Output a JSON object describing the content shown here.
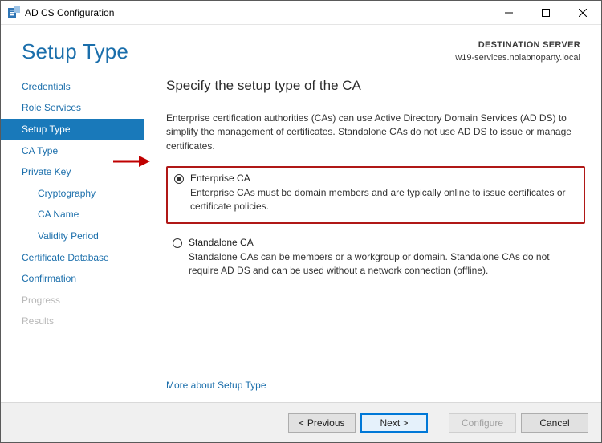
{
  "window": {
    "title": "AD CS Configuration"
  },
  "header": {
    "title": "Setup Type",
    "dest_label": "DESTINATION SERVER",
    "dest_server": "w19-services.nolabnoparty.local"
  },
  "sidebar": {
    "items": [
      {
        "label": "Credentials",
        "state": "normal",
        "sub": false
      },
      {
        "label": "Role Services",
        "state": "normal",
        "sub": false
      },
      {
        "label": "Setup Type",
        "state": "selected",
        "sub": false
      },
      {
        "label": "CA Type",
        "state": "normal",
        "sub": false
      },
      {
        "label": "Private Key",
        "state": "normal",
        "sub": false
      },
      {
        "label": "Cryptography",
        "state": "normal",
        "sub": true
      },
      {
        "label": "CA Name",
        "state": "normal",
        "sub": true
      },
      {
        "label": "Validity Period",
        "state": "normal",
        "sub": true
      },
      {
        "label": "Certificate Database",
        "state": "normal",
        "sub": false
      },
      {
        "label": "Confirmation",
        "state": "normal",
        "sub": false
      },
      {
        "label": "Progress",
        "state": "disabled",
        "sub": false
      },
      {
        "label": "Results",
        "state": "disabled",
        "sub": false
      }
    ]
  },
  "content": {
    "heading": "Specify the setup type of the CA",
    "description": "Enterprise certification authorities (CAs) can use Active Directory Domain Services (AD DS) to simplify the management of certificates. Standalone CAs do not use AD DS to issue or manage certificates.",
    "options": [
      {
        "label": "Enterprise CA",
        "checked": true,
        "highlighted": true,
        "desc": "Enterprise CAs must be domain members and are typically online to issue certificates or certificate policies."
      },
      {
        "label": "Standalone CA",
        "checked": false,
        "highlighted": false,
        "desc": "Standalone CAs can be members or a workgroup or domain. Standalone CAs do not require AD DS and can be used without a network connection (offline)."
      }
    ],
    "more_link": "More about Setup Type"
  },
  "footer": {
    "previous": "< Previous",
    "next": "Next >",
    "configure": "Configure",
    "cancel": "Cancel"
  }
}
